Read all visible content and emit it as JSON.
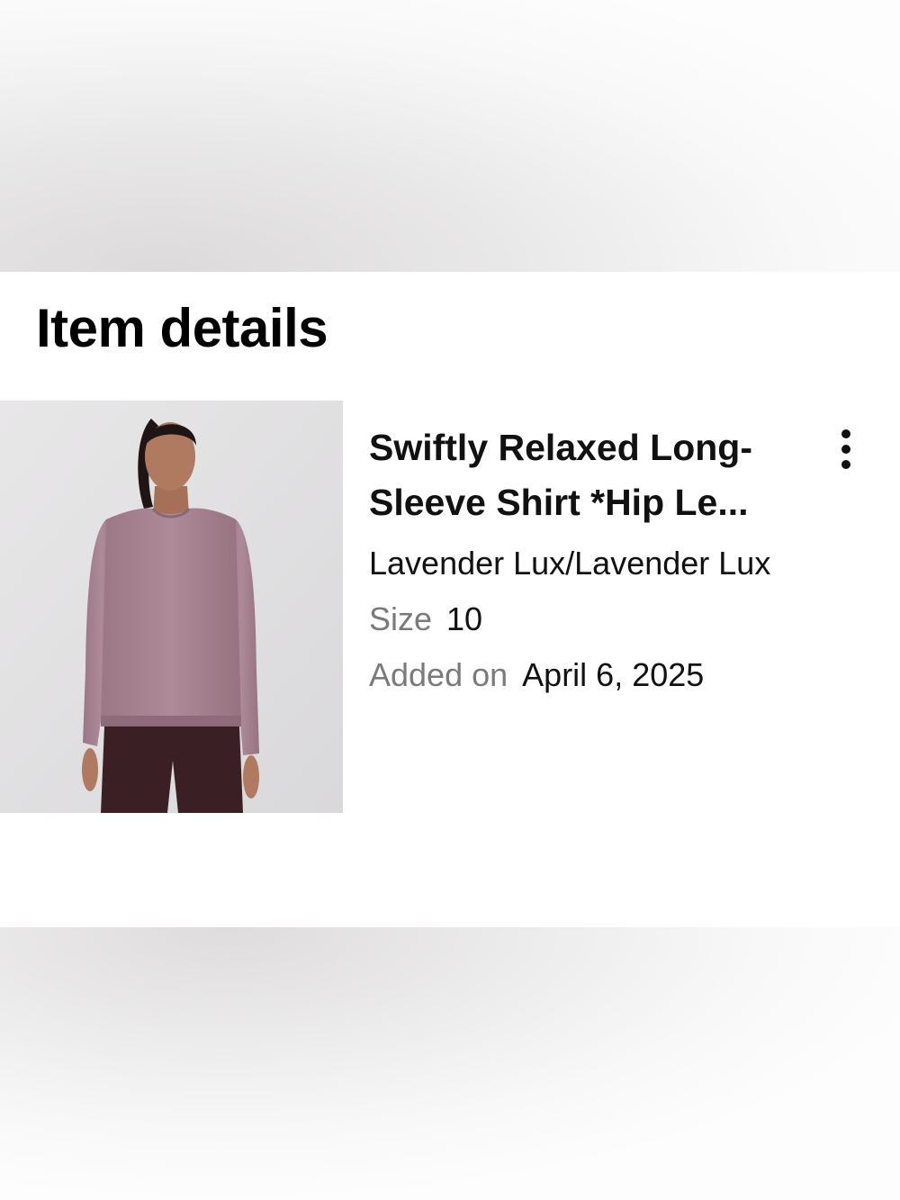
{
  "item_details": {
    "title": "Item details",
    "product": {
      "name": "Swiftly Relaxed Long-Sleeve Shirt *Hip Le...",
      "color": "Lavender Lux/Lavender Lux",
      "size_label": "Size",
      "size_value": "10",
      "added_label": "Added on",
      "added_value": "April 6, 2025",
      "image_icon": "product-photo",
      "more_options_icon": "more-vertical-icon"
    }
  },
  "colors": {
    "card_background": "#ffffff",
    "text_primary": "#111111",
    "text_secondary": "#7a7a7a",
    "shirt": "#a4818f",
    "leggings": "#3a2025"
  }
}
